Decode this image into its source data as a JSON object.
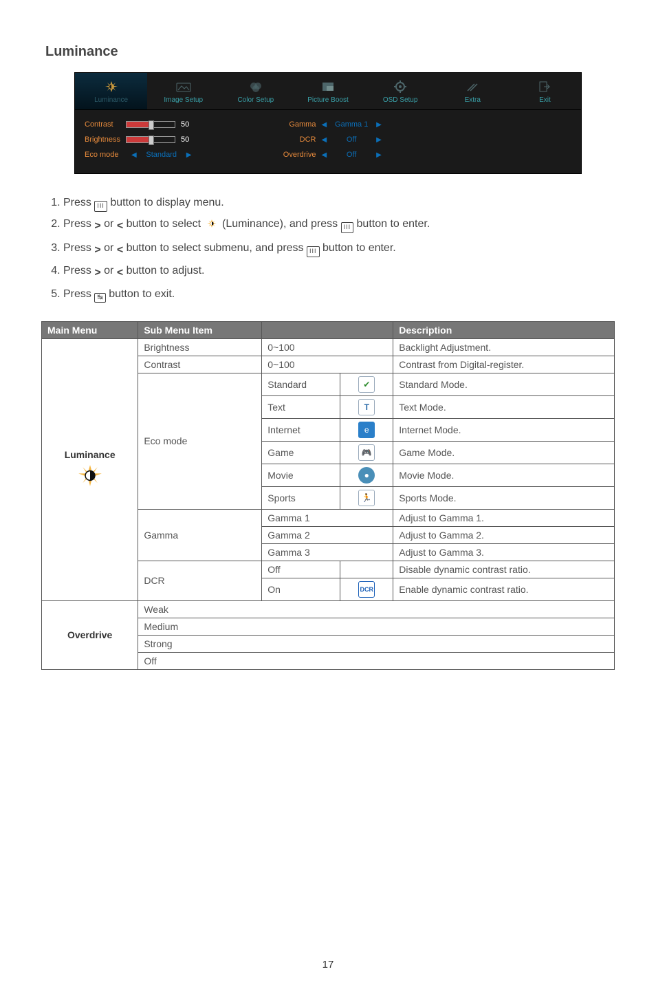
{
  "section_title": "Luminance",
  "page_number": "17",
  "osd": {
    "tabs": [
      {
        "label": "Luminance",
        "active": true
      },
      {
        "label": "Image Setup"
      },
      {
        "label": "Color Setup"
      },
      {
        "label": "Picture Boost"
      },
      {
        "label": "OSD Setup"
      },
      {
        "label": "Extra"
      },
      {
        "label": "Exit"
      }
    ],
    "left_col": [
      {
        "label": "Contrast",
        "type": "slider",
        "value": "50"
      },
      {
        "label": "Brightness",
        "type": "slider",
        "value": "50"
      },
      {
        "label": "Eco mode",
        "type": "select",
        "value": "Standard"
      }
    ],
    "right_col": [
      {
        "label": "Gamma",
        "type": "select",
        "value": "Gamma 1"
      },
      {
        "label": "DCR",
        "type": "select",
        "value": "Off"
      },
      {
        "label": "Overdrive",
        "type": "select",
        "value": "Off"
      }
    ]
  },
  "instructions": {
    "i1a": "Press ",
    "i1b": " button to display menu.",
    "i2a": "Press ",
    "i2b": " or ",
    "i2c": " button to select ",
    "i2d": " (Luminance), and press ",
    "i2e": " button to enter.",
    "i3a": "Press ",
    "i3b": " or ",
    "i3c": " button to select submenu, and press ",
    "i3d": " button to enter.",
    "i4a": "Press ",
    "i4b": " or ",
    "i4c": " button to adjust.",
    "i5a": "Press ",
    "i5b": " button to exit."
  },
  "table": {
    "head": {
      "c1": "Main Menu",
      "c2": "Sub Menu Item",
      "c3": "Description"
    },
    "luminance_label": "Luminance",
    "overdrive_label": "Overdrive",
    "rows": {
      "brightness": {
        "sub": "Brightness",
        "range": "0~100",
        "desc": "Backlight Adjustment."
      },
      "contrast": {
        "sub": "Contrast",
        "range": "0~100",
        "desc": "Contrast from Digital-register."
      },
      "eco": {
        "sub": "Eco mode"
      },
      "eco_standard": {
        "opt": "Standard",
        "desc": "Standard Mode."
      },
      "eco_text": {
        "opt": "Text",
        "desc": "Text Mode."
      },
      "eco_internet": {
        "opt": "Internet",
        "desc": "Internet Mode."
      },
      "eco_game": {
        "opt": "Game",
        "desc": "Game Mode."
      },
      "eco_movie": {
        "opt": "Movie",
        "desc": "Movie Mode."
      },
      "eco_sports": {
        "opt": "Sports",
        "desc": "Sports Mode."
      },
      "gamma": {
        "sub": "Gamma"
      },
      "gamma1": {
        "opt": "Gamma 1",
        "desc": "Adjust to Gamma 1."
      },
      "gamma2": {
        "opt": "Gamma 2",
        "desc": "Adjust to Gamma 2."
      },
      "gamma3": {
        "opt": "Gamma 3",
        "desc": "Adjust to Gamma 3."
      },
      "dcr": {
        "sub": "DCR"
      },
      "dcr_off": {
        "opt": "Off",
        "desc": "Disable dynamic contrast ratio."
      },
      "dcr_on": {
        "opt": "On",
        "desc": "Enable dynamic contrast ratio."
      },
      "od_weak": {
        "opt": "Weak"
      },
      "od_medium": {
        "opt": "Medium"
      },
      "od_strong": {
        "opt": "Strong"
      },
      "od_off": {
        "opt": "Off"
      }
    }
  }
}
